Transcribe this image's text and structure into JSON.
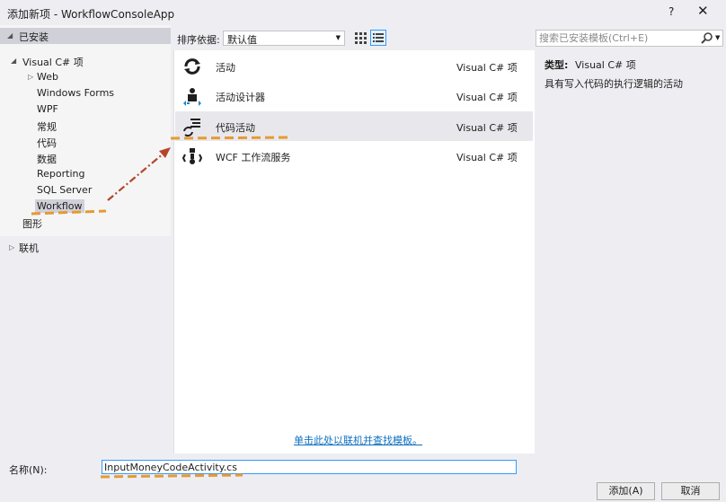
{
  "window": {
    "title": "添加新项 - WorkflowConsoleApp",
    "help": "?",
    "close": "✕"
  },
  "tree": {
    "installed": "已安装",
    "visual_csharp": "Visual C# 项",
    "children": [
      "Web",
      "Windows Forms",
      "WPF",
      "常规",
      "代码",
      "数据",
      "Reporting",
      "SQL Server",
      "Workflow"
    ],
    "graphics": "图形",
    "online": "联机"
  },
  "toolbar": {
    "sort_label": "排序依据:",
    "sort_value": "默认值"
  },
  "templates": [
    {
      "name": "活动",
      "type": "Visual C# 项",
      "icon": "activity-icon"
    },
    {
      "name": "活动设计器",
      "type": "Visual C# 项",
      "icon": "activity-designer-icon"
    },
    {
      "name": "代码活动",
      "type": "Visual C# 项",
      "icon": "code-activity-icon"
    },
    {
      "name": "WCF 工作流服务",
      "type": "Visual C# 项",
      "icon": "wcf-service-icon"
    }
  ],
  "online_link": "单击此处以联机并查找模板。",
  "search": {
    "placeholder": "搜索已安装模板(Ctrl+E)"
  },
  "details": {
    "type_label": "类型:",
    "type_value": "Visual C# 项",
    "description": "具有写入代码的执行逻辑的活动"
  },
  "name_field": {
    "label": "名称(N):",
    "value": "InputMoneyCodeActivity.cs"
  },
  "buttons": {
    "add": "添加(A)",
    "cancel": "取消"
  },
  "colors": {
    "accent": "#3399ff",
    "annotation_orange": "#e59a35",
    "annotation_arrow": "#b5452a",
    "selected_tree": "#d0d0d8"
  }
}
